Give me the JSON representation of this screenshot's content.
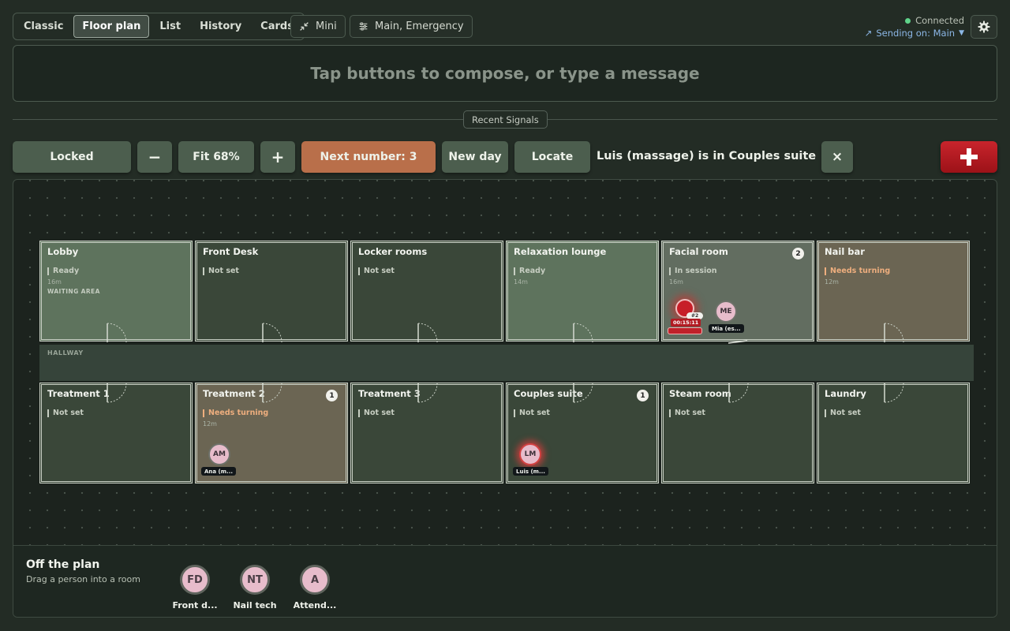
{
  "tabs": [
    "Classic",
    "Floor plan",
    "List",
    "History",
    "Cards"
  ],
  "active_tab": "Floor plan",
  "mini_label": "Mini",
  "channels_label": "Main, Emergency",
  "status": {
    "connected": "Connected",
    "sending": "Sending on: Main"
  },
  "compose": {
    "placeholder": "Tap buttons to compose, or type a message"
  },
  "recent_signals": "Recent Signals",
  "toolbar": {
    "locked": "Locked",
    "zoom_out": "−",
    "fit": "Fit 68%",
    "zoom_in": "+",
    "next_number": "Next number: 3",
    "new_day": "New day",
    "locate": "Locate",
    "locate_message": "Luis (massage) is in Couples suite",
    "close": "×"
  },
  "colors": {
    "accent_orange": "#b96f4a",
    "emergency_red": "#c8242c",
    "connected_green": "#5fd38a",
    "ready_room": "#5e735d",
    "needs_turning_room": "#6b6553",
    "not_set_room": "#3a4739"
  },
  "hallway_label": "HALLWAY",
  "rooms": [
    {
      "name": "Lobby",
      "status": "Ready",
      "time": "16m",
      "tag": "WAITING AREA",
      "count": ""
    },
    {
      "name": "Front Desk",
      "status": "Not set",
      "time": "",
      "tag": "",
      "count": ""
    },
    {
      "name": "Locker rooms",
      "status": "Not set",
      "time": "",
      "tag": "",
      "count": ""
    },
    {
      "name": "Relaxation lounge",
      "status": "Ready",
      "time": "14m",
      "tag": "",
      "count": ""
    },
    {
      "name": "Facial room",
      "status": "In session",
      "time": "16m",
      "tag": "",
      "count": "2"
    },
    {
      "name": "Nail bar",
      "status": "Needs turning",
      "time": "12m",
      "tag": "",
      "count": ""
    },
    {
      "name": "Treatment 1",
      "status": "Not set",
      "time": "",
      "tag": "",
      "count": ""
    },
    {
      "name": "Treatment 2",
      "status": "Needs turning",
      "time": "12m",
      "tag": "",
      "count": "1"
    },
    {
      "name": "Treatment 3",
      "status": "Not set",
      "time": "",
      "tag": "",
      "count": ""
    },
    {
      "name": "Couples suite",
      "status": "Not set",
      "time": "",
      "tag": "",
      "count": "1"
    },
    {
      "name": "Steam room",
      "status": "Not set",
      "time": "",
      "tag": "",
      "count": ""
    },
    {
      "name": "Laundry",
      "status": "Not set",
      "time": "",
      "tag": "",
      "count": ""
    }
  ],
  "people": [
    {
      "initials": "ME",
      "label": "Mia (es..."
    },
    {
      "initials": "AM",
      "label": "Ana (m..."
    },
    {
      "initials": "LM",
      "label": "Luis (m..."
    }
  ],
  "alarm": {
    "number": "#2",
    "timer": "00:15:11"
  },
  "off_plan": {
    "title": "Off the plan",
    "subtitle": "Drag a person into a room",
    "people": [
      {
        "initials": "FD",
        "label": "Front d..."
      },
      {
        "initials": "NT",
        "label": "Nail tech"
      },
      {
        "initials": "A",
        "label": "Attend..."
      }
    ]
  }
}
